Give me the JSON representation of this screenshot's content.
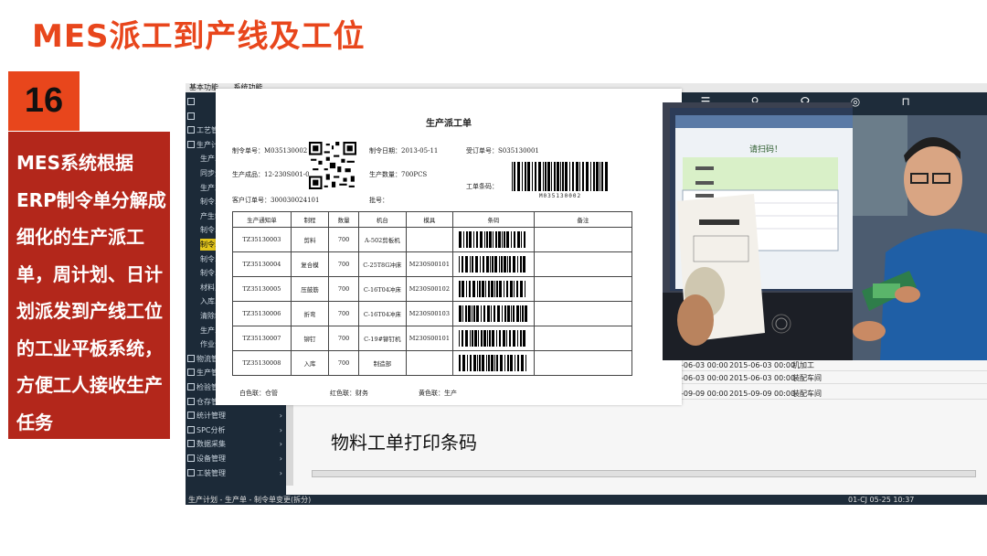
{
  "slide": {
    "title": "MES派工到产线及工位",
    "number": "16",
    "description": "MES系统根据ERP制令单分解成细化的生产派工单，周计划、日计划派发到产线工位的工业平板系统，方便工人接收生产任务",
    "caption": "物料工单打印条码"
  },
  "app": {
    "menu": [
      "基本功能",
      "系统功能"
    ],
    "sidebar": [
      {
        "label": "",
        "level": 0
      },
      {
        "label": "",
        "level": 0
      },
      {
        "label": "工艺管",
        "level": 0
      },
      {
        "label": "生产计",
        "level": 0
      },
      {
        "label": "生产单",
        "level": 1
      },
      {
        "label": "同步生",
        "level": 1
      },
      {
        "label": "生产工",
        "level": 1
      },
      {
        "label": "制令单",
        "level": 1
      },
      {
        "label": "产生制",
        "level": 1
      },
      {
        "label": "制令单",
        "level": 1
      },
      {
        "label": "制令单",
        "level": 1,
        "selected": true
      },
      {
        "label": "制令单",
        "level": 1
      },
      {
        "label": "制令单",
        "level": 1
      },
      {
        "label": "材料入",
        "level": 1
      },
      {
        "label": "入库单",
        "level": 1
      },
      {
        "label": "清除制",
        "level": 1
      },
      {
        "label": "生产单",
        "level": 1
      },
      {
        "label": "作业计",
        "level": 1
      },
      {
        "label": "物流管",
        "level": 0
      },
      {
        "label": "生产管",
        "level": 0
      },
      {
        "label": "检验管",
        "level": 0
      },
      {
        "label": "仓存管理",
        "level": 0,
        "arrow": true
      },
      {
        "label": "统计管理",
        "level": 0,
        "arrow": true
      },
      {
        "label": "SPC分析",
        "level": 0,
        "arrow": true
      },
      {
        "label": "数据采集",
        "level": 0,
        "arrow": true
      },
      {
        "label": "设备管理",
        "level": 0,
        "arrow": true
      },
      {
        "label": "工装管理",
        "level": 0,
        "arrow": true
      }
    ],
    "grid_rows": [
      {
        "c1": "-06-03 00:00",
        "c2": "2015-06-03 00:00",
        "c3": "机加工"
      },
      {
        "c1": "-06-03 00:00",
        "c2": "2015-06-03 00:00",
        "c3": "装配车间"
      },
      {
        "c1": "-09-09 00:00",
        "c2": "2015-09-09 00:00",
        "c3": "装配车间"
      }
    ],
    "status_left": "生产计划 - 生产单 - 制令单变更(拆分)",
    "status_right": "01-CJ 05-25 10:37"
  },
  "work_order": {
    "title": "生产派工单",
    "order_no": "制令单号：M035130002",
    "date": "制令日期：2013-05-11",
    "accept_no": "受订单号：S035130001",
    "product": "生产成品：12-230S001-0",
    "quantity": "生产数量：700PCS",
    "order_barcode": "工单条码：",
    "barcode_text": "M035130002",
    "customer": "客户订单号：300030024101",
    "batch": "批号：",
    "columns": [
      "生产通知单",
      "制程",
      "数量",
      "机台",
      "模具",
      "条码",
      "备注"
    ],
    "rows": [
      {
        "notice": "TZ35130003",
        "process": "剪料",
        "qty": "700",
        "machine": "A-502剪板机",
        "mold": "",
        "note": ""
      },
      {
        "notice": "TZ35130004",
        "process": "复合模",
        "qty": "700",
        "machine": "C-25T8G冲床",
        "mold": "M230S00101",
        "note": ""
      },
      {
        "notice": "TZ35130005",
        "process": "压鼓筋",
        "qty": "700",
        "machine": "C-16T04冲床",
        "mold": "M230S00102",
        "note": ""
      },
      {
        "notice": "TZ35130006",
        "process": "折弯",
        "qty": "700",
        "machine": "C-16T04冲床",
        "mold": "M230S00103",
        "note": ""
      },
      {
        "notice": "TZ35130007",
        "process": "铆钉",
        "qty": "700",
        "machine": "C-19#铆钉机",
        "mold": "M230S00101",
        "note": ""
      },
      {
        "notice": "TZ35130008",
        "process": "入库",
        "qty": "700",
        "machine": "制造部",
        "mold": "",
        "note": ""
      }
    ],
    "footer": [
      "白色联：仓管",
      "红色联：财务",
      "黄色联：生产"
    ]
  },
  "photo": {
    "screen_text": "请扫码！"
  }
}
